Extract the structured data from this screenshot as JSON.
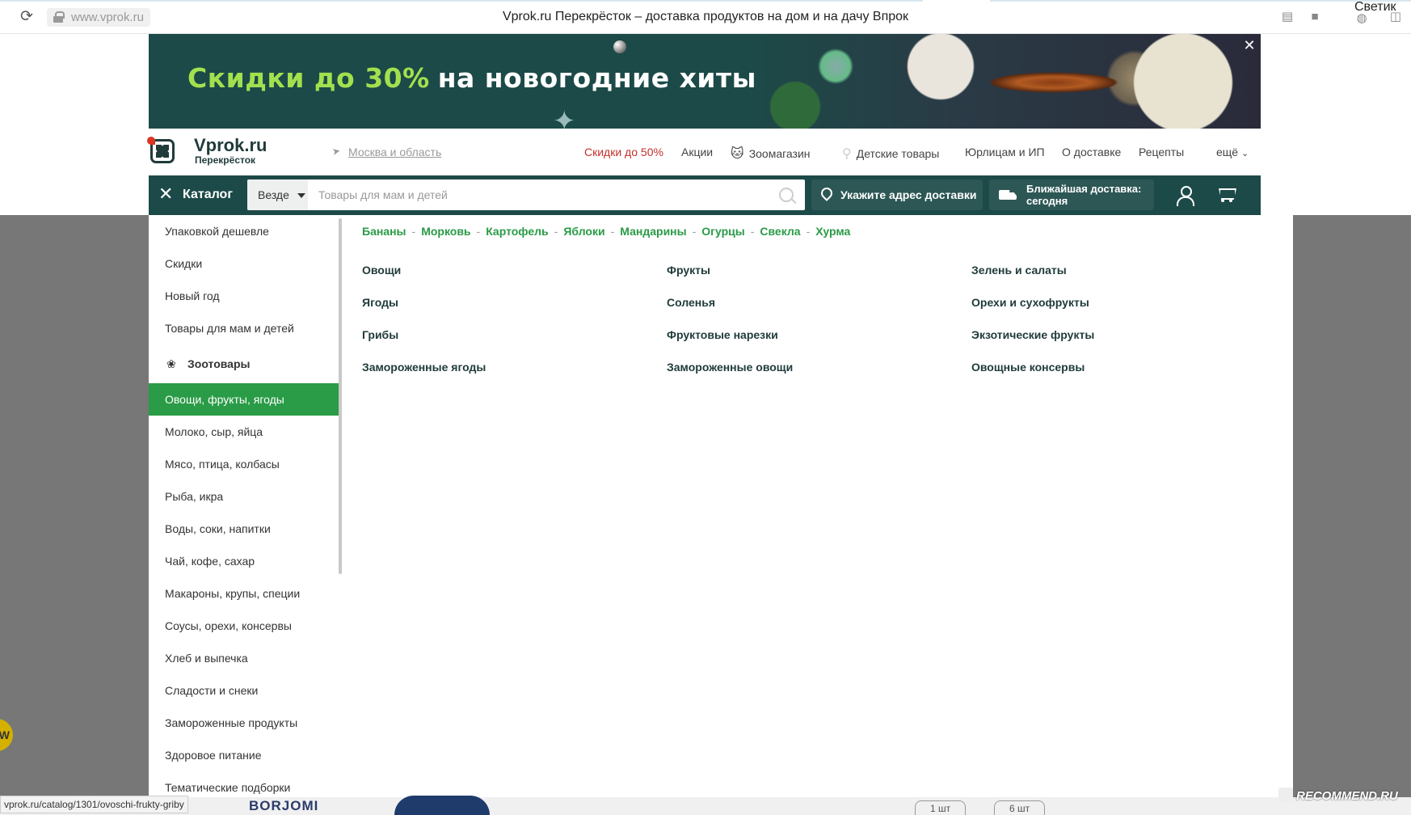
{
  "browser": {
    "url": "www.vprok.ru",
    "title": "Vprok.ru Перекрёсток – доставка продуктов на дом и на дачу Впрок",
    "profile": "Светик"
  },
  "banner": {
    "headline_green": "Скидки до 30%",
    "headline_white": "на новогодние хиты",
    "close": "✕"
  },
  "header": {
    "logo_name": "Vprok.ru",
    "logo_sub": "Перекрёсток",
    "region": "Москва и область",
    "nav": {
      "sale": "Скидки до 50%",
      "promos": "Акции",
      "zoo": "Зоомагазин",
      "kids": "Детские товары",
      "business": "Юрлицам и ИП",
      "delivery": "О доставке",
      "recipes": "Рецепты",
      "more": "ещё"
    }
  },
  "catalog_bar": {
    "catalog_label": "Каталог",
    "scope": "Везде",
    "search_placeholder": "Товары для мам и детей",
    "address_label": "Укажите адрес доставки",
    "delivery_line1": "Ближайшая доставка:",
    "delivery_line2": "сегодня"
  },
  "sidebar": {
    "items": [
      "Упаковкой дешевле",
      "Скидки",
      "Новый год",
      "Товары для мам и детей",
      "Зоотовары",
      "Овощи, фрукты, ягоды",
      "Молоко, сыр, яйца",
      "Мясо, птица, колбасы",
      "Рыба, икра",
      "Воды, соки, напитки",
      "Чай, кофе, сахар",
      "Макароны, крупы, специи",
      "Соусы, орехи, консервы",
      "Хлеб и выпечка",
      "Сладости и снеки",
      "Замороженные продукты",
      "Здоровое питание",
      "Тематические подборки"
    ],
    "active_index": 5
  },
  "content": {
    "quick_links": [
      "Бананы",
      "Морковь",
      "Картофель",
      "Яблоки",
      "Мандарины",
      "Огурцы",
      "Свекла",
      "Хурма"
    ],
    "separator": "-",
    "categories": {
      "col1": [
        "Овощи",
        "Ягоды",
        "Грибы",
        "Замороженные ягоды"
      ],
      "col2": [
        "Фрукты",
        "Соленья",
        "Фруктовые нарезки",
        "Замороженные овощи"
      ],
      "col3": [
        "Зелень и салаты",
        "Орехи и сухофрукты",
        "Экзотические фрукты",
        "Овощные консервы"
      ]
    }
  },
  "bottom": {
    "status_url": "vprok.ru/catalog/1301/ovoschi-frukty-griby",
    "borjomi": "BORJOMI",
    "qty1": "1 шт",
    "qty2": "6 шт",
    "badge": "W",
    "watermark": "RECOMMEND.RU"
  },
  "colors": {
    "brand_dark": "#1c4a48",
    "accent_green": "#2a9b46",
    "sale_red": "#c4302b"
  }
}
